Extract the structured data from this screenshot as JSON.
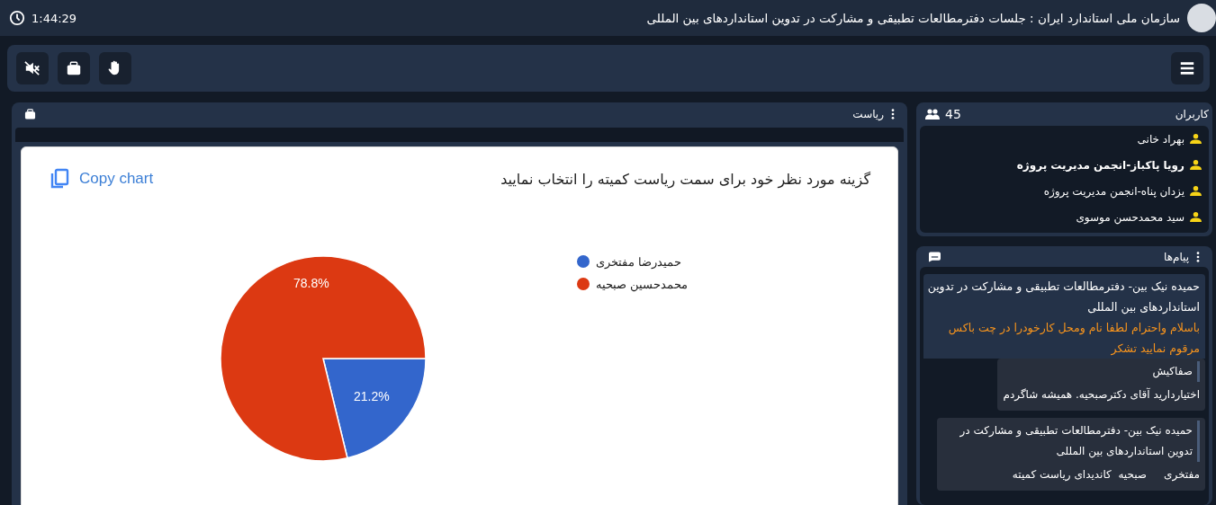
{
  "header": {
    "title": "سازمان ملی استاندارد ایران : جلسات دفترمطالعات تطبیقی و مشارکت در تدوین استانداردهای بین المللی",
    "time": "1:44:29"
  },
  "toolbar": {
    "buttons": [
      {
        "kind": "hand"
      },
      {
        "kind": "box"
      },
      {
        "kind": "mute"
      }
    ]
  },
  "presentation": {
    "title": "ریاست",
    "card": {
      "question": "گزینه مورد نظر خود برای سمت ریاست کمیته را انتخاب نمایید",
      "copy_label": "Copy chart",
      "chart_data": {
        "type": "pie",
        "categories": [
          "حمیدرضا مفتخری",
          "محمدحسین صبحیه"
        ],
        "values": [
          21.2,
          78.8
        ],
        "colors": [
          "#3366cc",
          "#dc3912"
        ],
        "value_labels": [
          "21.2%",
          "78.8%"
        ],
        "legend": "right"
      }
    }
  },
  "users": {
    "title": "کاربران",
    "count": "45",
    "items": [
      {
        "name": "بهراد خانی",
        "highlighted": false
      },
      {
        "name": "رویا پاکباز-انجمن مدیریت پروژه",
        "highlighted": true
      },
      {
        "name": "یزدان پناه-انجمن مدیریت پروژه",
        "highlighted": false
      },
      {
        "name": "سید محمدحسن موسوی",
        "highlighted": false
      }
    ]
  },
  "messages": {
    "title": "پیام‌ها",
    "items": [
      {
        "kind": "announcement",
        "sender": "حمیده نیک بین- دفترمطالعات تطبیقی و مشارکت در تدوین استانداردهای بین المللی",
        "text": "باسلام واحترام لطفا نام ومحل کارخودرا در چت باکس مرقوم نمایید تشکر"
      },
      {
        "kind": "reply",
        "sender": "صفاکیش",
        "text": "اختیاردارید آقای دکترصبحیه. همیشه شاگردم"
      },
      {
        "kind": "reply",
        "sender": "حمیده نیک بین- دفترمطالعات تطبیقی و مشارکت در تدوین استانداردهای بین المللی",
        "text": "مفتخری     صبحیه  کاندیدای ریاست کمیته"
      }
    ]
  }
}
